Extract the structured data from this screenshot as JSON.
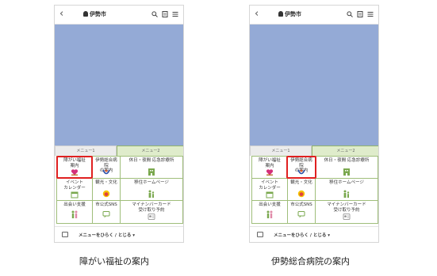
{
  "screens": [
    {
      "header": {
        "back": "‹",
        "title": "伊勢市"
      },
      "tabs": [
        "メニュー1",
        "メニュー2"
      ],
      "cells": [
        {
          "label": "障がい福祉\n案内",
          "icon": "heart-hand-icon"
        },
        {
          "label": "伊勢総合病院\nの案内",
          "icon": "hospital-logo-icon"
        },
        {
          "label": "休日・夜間 応急診療所",
          "icon": "building-icon"
        },
        {
          "label": "イベント\nカレンダー",
          "icon": "calendar-icon"
        },
        {
          "label": "観光・文化",
          "icon": "mascot-icon"
        },
        {
          "label": "移住ホームページ",
          "icon": "family-icon"
        },
        {
          "label": "出会い支援",
          "icon": "couple-icon"
        },
        {
          "label": "市公式SNS",
          "icon": "chat-icon"
        },
        {
          "label": "マイナンバーカード\n受け取り予約",
          "icon": "id-card-icon"
        }
      ],
      "highlight_cell": 0,
      "footer": "メニューをひらく / とじる ▾"
    },
    {
      "header": {
        "back": "‹",
        "title": "伊勢市"
      },
      "tabs": [
        "メニュー1",
        "メニュー2"
      ],
      "cells": [
        {
          "label": "障がい福祉\n案内",
          "icon": "heart-hand-icon"
        },
        {
          "label": "伊勢総合病院\nの案内",
          "icon": "hospital-logo-icon"
        },
        {
          "label": "休日・夜間 応急診療所",
          "icon": "building-icon"
        },
        {
          "label": "イベント\nカレンダー",
          "icon": "calendar-icon"
        },
        {
          "label": "観光・文化",
          "icon": "mascot-icon"
        },
        {
          "label": "移住ホームページ",
          "icon": "family-icon"
        },
        {
          "label": "出会い支援",
          "icon": "couple-icon"
        },
        {
          "label": "市公式SNS",
          "icon": "chat-icon"
        },
        {
          "label": "マイナンバーカード\n受け取り予約",
          "icon": "id-card-icon"
        }
      ],
      "highlight_cell": 1,
      "footer": "メニューをひらく / とじる ▾"
    }
  ],
  "captions": [
    "障がい福祉の案内",
    "伊勢総合病院の案内"
  ],
  "colors": {
    "map": "#94aad6",
    "grid_border": "#9fbe7a",
    "tab_active": "#dfeccb",
    "highlight": "#e02020",
    "icon_green": "#7aa84e"
  }
}
